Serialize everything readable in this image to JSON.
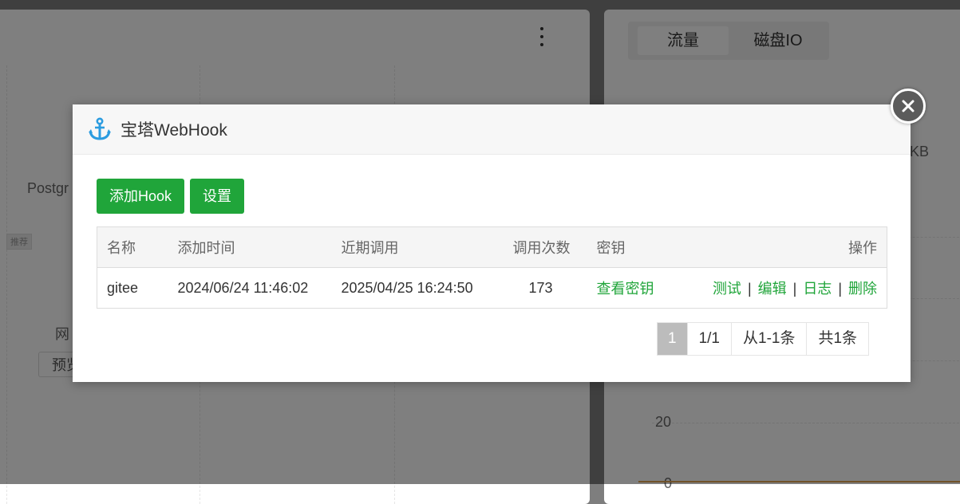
{
  "background": {
    "partial_label_1": "Postgr",
    "recommend_tag": "推荐",
    "partial_label_2": "网",
    "preview_button": "预览",
    "tabs": [
      "流量",
      "磁盘IO"
    ],
    "unit_fragment": "KB",
    "axis_ticks": [
      "20",
      "0"
    ]
  },
  "modal": {
    "title": "宝塔WebHook",
    "icon": "anchor-icon",
    "buttons": {
      "add_hook": "添加Hook",
      "settings": "设置"
    },
    "table": {
      "headers": [
        "名称",
        "添加时间",
        "近期调用",
        "调用次数",
        "密钥",
        "操作"
      ],
      "rows": [
        {
          "name": "gitee",
          "added": "2024/06/24 11:46:02",
          "last_call": "2025/04/25 16:24:50",
          "count": "173",
          "key_link": "查看密钥",
          "actions": [
            "测试",
            "编辑",
            "日志",
            "删除"
          ]
        }
      ]
    },
    "pagination": {
      "current": "1",
      "pages": "1/1",
      "range": "从1-1条",
      "total": "共1条"
    }
  },
  "colors": {
    "accent": "#20a53a",
    "overlay": "rgba(0,0,0,0.5)"
  }
}
